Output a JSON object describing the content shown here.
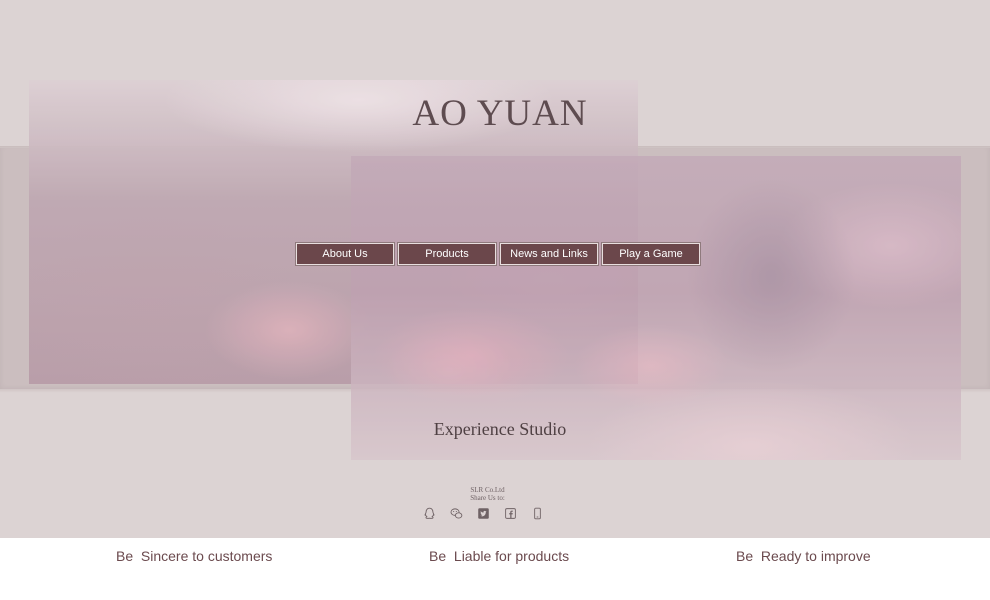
{
  "header": {
    "title": "AO YUAN"
  },
  "nav": {
    "items": [
      {
        "label": "About Us"
      },
      {
        "label": "Products"
      },
      {
        "label": "News and Links"
      },
      {
        "label": "Play a Game"
      }
    ]
  },
  "main": {
    "subtitle": "Experience Studio"
  },
  "footer": {
    "company": "SLR Co.Ltd",
    "share_label": "Share Us to:",
    "share_icons": [
      "qq-icon",
      "wechat-icon",
      "twitter-icon",
      "facebook-icon",
      "mobile-icon"
    ]
  },
  "mottos": [
    "Be  Sincere to customers",
    "Be  Liable for products",
    "Be  Ready to improve"
  ],
  "colors": {
    "background": "#dcd3d3",
    "nav_button": "#6b474b",
    "title_text": "#5e4c50",
    "motto_text": "#6b4a4e"
  }
}
